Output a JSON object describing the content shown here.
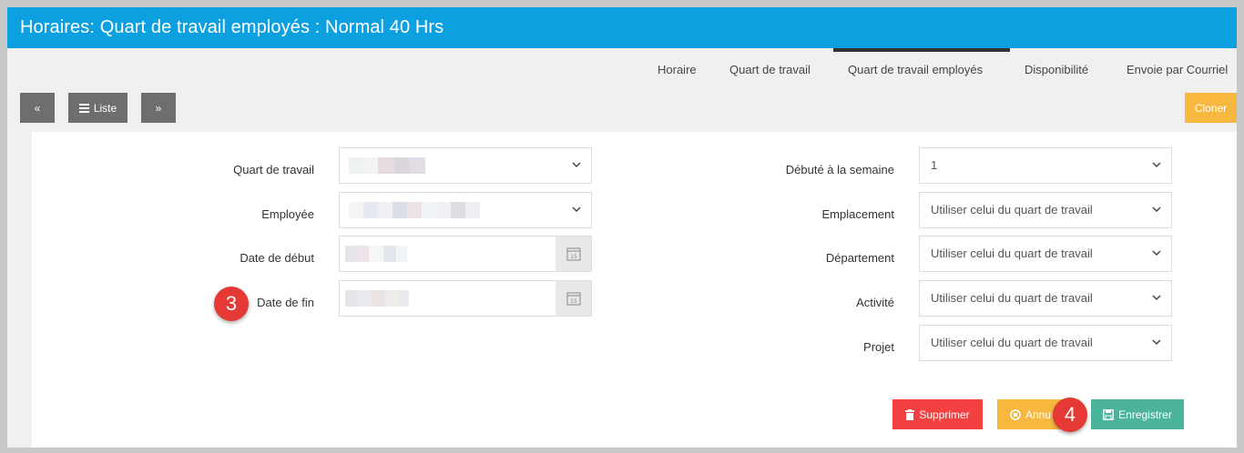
{
  "header": {
    "title": "Horaires: Quart de travail employés : Normal 40 Hrs"
  },
  "tabs": [
    {
      "label": "Horaire"
    },
    {
      "label": "Quart de travail"
    },
    {
      "label": "Quart de travail employés",
      "active": true
    },
    {
      "label": "Disponibilité"
    },
    {
      "label": "Envoie par Courriel"
    }
  ],
  "toolbar": {
    "prev_label": "«",
    "list_label": "Liste",
    "next_label": "»",
    "clone_label": "Cloner"
  },
  "form": {
    "shift_label": "Quart de travail",
    "employee_label": "Employée",
    "start_date_label": "Date de début",
    "end_date_label": "Date de fin",
    "week_start_label": "Débuté à la semaine",
    "week_start_value": "1",
    "location_label": "Emplacement",
    "location_value": "Utiliser celui du quart de travail",
    "department_label": "Département",
    "department_value": "Utiliser celui du quart de travail",
    "activity_label": "Activité",
    "activity_value": "Utiliser celui du quart de travail",
    "project_label": "Projet",
    "project_value": "Utiliser celui du quart de travail"
  },
  "actions": {
    "delete_label": "Supprimer",
    "cancel_label": "Annu",
    "save_label": "Enregistrer"
  },
  "annotations": {
    "step3": "3",
    "step4": "4"
  },
  "colors": {
    "titlebar": "#0da0e0",
    "amber": "#f8b840",
    "red": "#f44040",
    "teal": "#4bb49a",
    "badge": "#e53935"
  }
}
